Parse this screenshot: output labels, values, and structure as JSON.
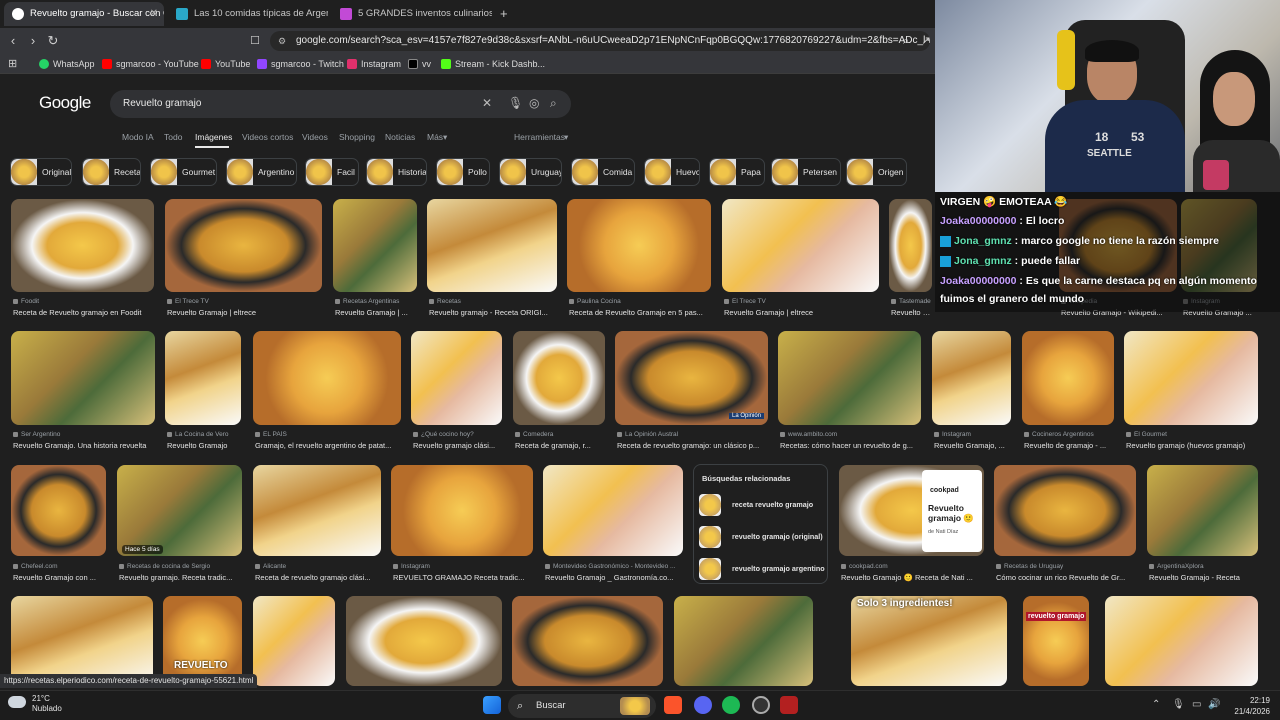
{
  "browser": {
    "tabs": [
      {
        "label": "Revuelto gramajo - Buscar con Google",
        "active": true
      },
      {
        "label": "Las 10 comidas típicas de Argentina",
        "active": false
      },
      {
        "label": "5 GRANDES inventos culinarios argentinos",
        "active": false
      }
    ],
    "new_tab": "+",
    "url": "google.com/search?sca_esv=4157e7f827e9d38c&sxsrf=ANbL-n6uUCweeaD2p71ENpNCnFqp0BGQQw:1776820769227&udm=2&fbs=ADc_l-bp...",
    "bookmarks": [
      "WhatsApp",
      "sgmarcoo - YouTube",
      "YouTube",
      "sgmarcoo - Twitch",
      "Instagram",
      "vv",
      "Stream - Kick Dashb..."
    ]
  },
  "google": {
    "logo": "Google",
    "query": "Revuelto gramajo",
    "tabs": [
      "Modo IA",
      "Todo",
      "Imágenes",
      "Videos cortos",
      "Videos",
      "Shopping",
      "Noticias",
      "Más",
      "Herramientas"
    ],
    "chips": [
      "Original",
      "Receta",
      "Gourmet",
      "Argentino",
      "Facil",
      "Historia",
      "Pollo",
      "Uruguay",
      "Comida",
      "Huevo",
      "Papa",
      "Petersen",
      "Origen"
    ],
    "row1": [
      {
        "src": "Foodit",
        "title": "Receta de Revuelto gramajo en Foodit"
      },
      {
        "src": "El Trece TV",
        "title": "Revuelto Gramajo | eltrece"
      },
      {
        "src": "Recetas Argentinas",
        "title": "Revuelto Gramajo | ..."
      },
      {
        "src": "Recetas",
        "title": "Revuelto gramajo - Receta ORIGI..."
      },
      {
        "src": "Paulina Cocina",
        "title": "Receta de Revuelto Gramajo en 5 pas..."
      },
      {
        "src": "El Trece TV",
        "title": "Revuelto Gramajo | eltrece"
      },
      {
        "src": "Tastemade",
        "title": "Revuelto Gramajo | Tastemade"
      },
      {
        "src": "Wikipedia",
        "title": "Revuelto Gramajo - Wikipedi..."
      },
      {
        "src": "Instagram",
        "title": "Revuelto Gramajo ..."
      }
    ],
    "row2": [
      {
        "src": "Ser Argentino",
        "title": "Revuelto Gramajo. Una historia revuelta"
      },
      {
        "src": "La Cocina de Vero",
        "title": "Revuelto Gramajo"
      },
      {
        "src": "EL PAÍS",
        "title": "Gramajo, el revuelto argentino de patat..."
      },
      {
        "src": "¿Qué cocino hoy?",
        "title": "Revuelto gramajo clási..."
      },
      {
        "src": "Comedera",
        "title": "Receta de gramajo, r..."
      },
      {
        "src": "La Opinión Austral",
        "title": "Receta de revuelto gramajo: un clásico p..."
      },
      {
        "src": "www.ambito.com",
        "title": "Recetas: cómo hacer un revuelto de g..."
      },
      {
        "src": "Instagram",
        "title": "Revuelto Gramajo, ..."
      },
      {
        "src": "Cocineros Argentinos",
        "title": "Revuelto de gramajo - ..."
      },
      {
        "src": "El Gourmet",
        "title": "Revuelto gramajo (huevos gramajo)"
      }
    ],
    "row3": [
      {
        "src": "Chefeel.com",
        "title": "Revuelto Gramajo con ..."
      },
      {
        "src": "Recetas de cocina de Sergio",
        "title": "Revuelto gramajo. Receta tradic..."
      },
      {
        "src": "Alicante",
        "title": "Receta de revuelto gramajo clási..."
      },
      {
        "src": "Instagram",
        "title": "REVUELTO GRAMAJO Receta tradic..."
      },
      {
        "src": "Montevideo Gastronómico - Montevideo ...",
        "title": "Revuelto Gramajo _ Gastronomía.co..."
      },
      {
        "src": "cookpad.com",
        "title": "Revuelto Gramajo 🙂 Receta de Nati ..."
      },
      {
        "src": "Recetas de Uruguay",
        "title": "Cómo cocinar un rico Revuelto de Gr..."
      },
      {
        "src": "ArgentinaXplora",
        "title": "Revuelto Gramajo - Receta"
      }
    ],
    "related": {
      "title": "Búsquedas relacionadas",
      "items": [
        "receta revuelto gramajo",
        "revuelto gramajo (original)",
        "revuelto gramajo argentino"
      ]
    },
    "overlay_texts": {
      "hace": "Hace 5 días",
      "cookpad_logo": "cookpad",
      "cookpad_title": "Revuelto gramajo 🙂",
      "cookpad_author": "de Nati Díaz",
      "revuelto_word": "REVUELTO",
      "solo": "Solo 3 ingredientes!",
      "rg_small": "revuelto gramajo",
      "laopinion": "La Opinión"
    }
  },
  "stream": {
    "chat": [
      {
        "user": "",
        "text": "VIRGEN 🤪 EMOTEAA 😂"
      },
      {
        "user": "Joaka00000000",
        "text": "El locro"
      },
      {
        "user": "Jona_gmnz",
        "text": "marco google no tiene la razón siempre"
      },
      {
        "user": "Jona_gmnz",
        "text": "puede fallar"
      },
      {
        "user": "Joaka00000000",
        "text": "Es que la carne destaca pq en algún momento"
      },
      {
        "user": "",
        "text": "fuimos el granero del mundo"
      }
    ],
    "jersey_number": "18",
    "jersey_num2": "53",
    "jersey_word": "SEATTLE"
  },
  "status_url": "https://recetas.elperiodico.com/receta-de-revuelto-gramajo-55621.html",
  "taskbar": {
    "temp": "21°C",
    "weather": "Nublado",
    "search": "Buscar",
    "time": "22:19",
    "date": "21/4/2026"
  },
  "colors": {
    "food_yellow": "#e8b432",
    "background": "#1f1f1f"
  }
}
